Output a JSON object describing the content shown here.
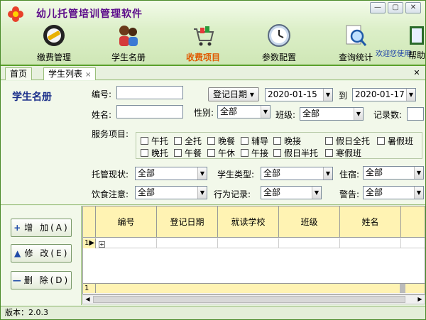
{
  "app": {
    "title": "幼儿托管培训管理软件",
    "welcome": "欢迎您使用"
  },
  "nav": [
    {
      "label": "缴费管理",
      "icon": "payment-icon"
    },
    {
      "label": "学生名册",
      "icon": "students-icon"
    },
    {
      "label": "收费项目",
      "icon": "fee-items-icon",
      "active": true
    },
    {
      "label": "参数配置",
      "icon": "clock-settings-icon"
    },
    {
      "label": "查询统计",
      "icon": "search-stats-icon"
    },
    {
      "label": "帮助",
      "icon": "help-book-icon"
    }
  ],
  "tabs": [
    {
      "label": "首页"
    },
    {
      "label": "学生列表",
      "close": "×"
    }
  ],
  "tabs_close": "✕",
  "panel_title": "学生名册",
  "form": {
    "id_label": "编号:",
    "date_button": "登记日期",
    "date_from": "2020-01-15",
    "to_label": "到",
    "date_to": "2020-01-17",
    "name_label": "姓名:",
    "gender_label": "性别:",
    "gender_value": "全部",
    "class_label": "班级:",
    "class_value": "全部",
    "records_label": "记录数:",
    "services_label": "服务项目:",
    "services": [
      "午托",
      "全托",
      "晚餐",
      "辅导",
      "晚接",
      "假日全托",
      "暑假班",
      "晚托",
      "午餐",
      "午休",
      "午接",
      "假日半托",
      "寒假班"
    ],
    "custody_label": "托管现状:",
    "custody_value": "全部",
    "student_type_label": "学生类型:",
    "student_type_value": "全部",
    "boarding_label": "住宿:",
    "boarding_value": "全部",
    "diet_label": "饮食注意:",
    "diet_value": "全部",
    "behavior_label": "行为记录:",
    "behavior_value": "全部",
    "warning_label": "警告:",
    "warning_value": "全部"
  },
  "side_buttons": [
    {
      "icon": "+",
      "label": "增 加(A)"
    },
    {
      "icon": "▲",
      "label": "修 改(E)"
    },
    {
      "icon": "—",
      "label": "删 除(D)"
    }
  ],
  "grid": {
    "columns": [
      "编号",
      "登记日期",
      "就读学校",
      "班级",
      "姓名"
    ],
    "row_marker": "1",
    "footer_marker": "1"
  },
  "status": {
    "version": "版本：2.0.3"
  },
  "colors": {
    "accent": "#e05a00",
    "title": "#5b0a8a",
    "header": "#fff3b3"
  }
}
